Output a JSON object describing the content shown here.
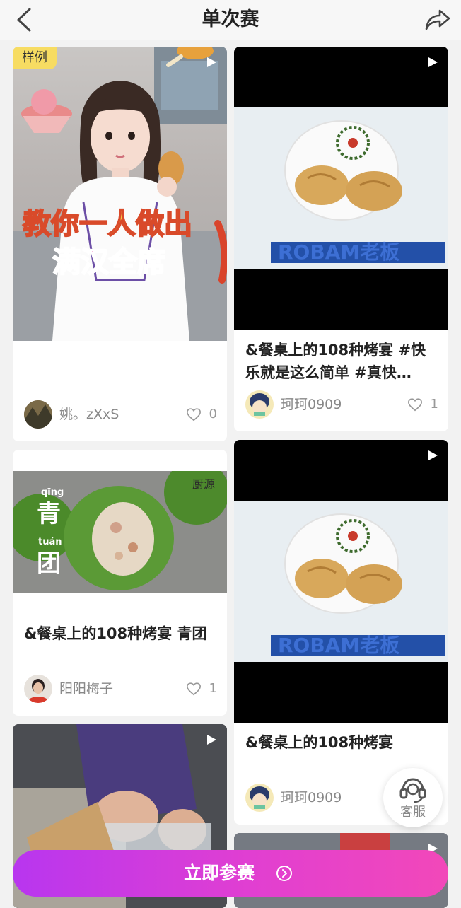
{
  "header": {
    "title": "单次赛"
  },
  "cards": [
    {
      "badge": "样例",
      "overlay_line1": "教你一人做出",
      "overlay_line2": "满汉全席",
      "author": "姚。zXxS",
      "likes": "0"
    },
    {
      "title": "&餐桌上的108种烤宴 #快乐就是这么简单 #真快…",
      "brand": "ROBAM老板",
      "author": "珂珂0909",
      "likes": "1"
    },
    {
      "title": "&餐桌上的108种烤宴 青团",
      "overlay_pinyin1": "qīng",
      "overlay_char1": "青",
      "overlay_pinyin2": "tuán",
      "overlay_char2": "团",
      "watermark": "厨源",
      "author": "阳阳梅子",
      "likes": "1"
    },
    {
      "title": "&餐桌上的108种烤宴",
      "brand": "ROBAM老板",
      "author": "珂珂0909"
    }
  ],
  "service": {
    "label": "客服"
  },
  "cta": {
    "label": "立即参赛"
  },
  "colors": {
    "accent_start": "#b836ef",
    "accent_end": "#f248b9",
    "badge": "#f7dc62"
  }
}
